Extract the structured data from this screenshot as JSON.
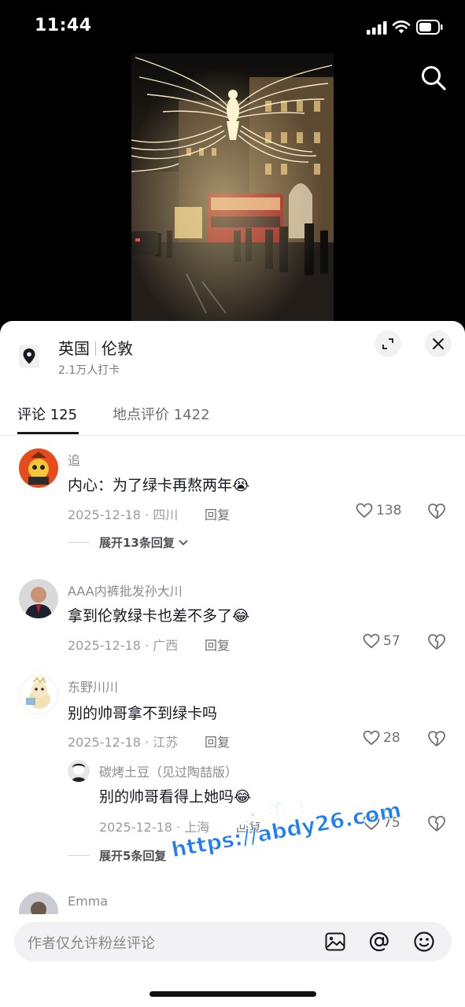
{
  "status_bar": {
    "time": "11:44"
  },
  "location": {
    "country": "英国",
    "city": "伦敦",
    "checkins": "2.1万人打卡"
  },
  "tabs": [
    {
      "label": "评论 125"
    },
    {
      "label": "地点评价 1422"
    }
  ],
  "comments": [
    {
      "user": "追",
      "text": "内心：为了绿卡再熬两年",
      "emoji": "😭",
      "date": "2025-12-18 · 四川",
      "reply_label": "回复",
      "likes": "138",
      "expand": "展开13条回复"
    },
    {
      "user": "AAA内裤批发孙大川",
      "text": "拿到伦敦绿卡也差不多了",
      "emoji": "😂",
      "date": "2025-12-18 · 广西",
      "reply_label": "回复",
      "likes": "57"
    },
    {
      "user": "东野川川",
      "text": "别的帅哥拿不到绿卡吗",
      "date": "2025-12-18 · 江苏",
      "reply_label": "回复",
      "likes": "28"
    },
    {
      "user": "碳烤土豆（见过陶喆版）",
      "text": "别的帅哥看得上她吗",
      "emoji": "😂",
      "date": "2025-12-18 · 上海",
      "reply_label": "回复",
      "likes": "75",
      "expand": "展开5条回复"
    },
    {
      "user": "Emma"
    }
  ],
  "watermark": {
    "line1": "黑料不打烊",
    "line2": "https://abdy26.com"
  },
  "input": {
    "placeholder": "作者仅允许粉丝评论"
  },
  "icons": [
    "location-pin-icon",
    "expand-icon",
    "close-icon",
    "heart-icon",
    "broken-heart-icon",
    "image-icon",
    "at-icon",
    "emoji-icon",
    "search-icon"
  ]
}
